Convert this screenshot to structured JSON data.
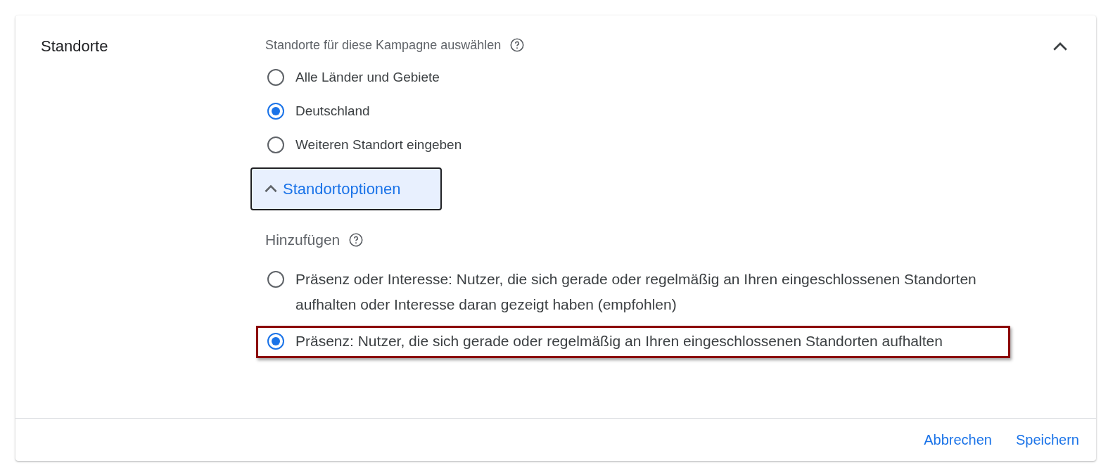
{
  "section": {
    "title": "Standorte",
    "expanded": true
  },
  "prompt": {
    "text": "Standorte für diese Kampagne auswählen"
  },
  "locations": [
    {
      "label": "Alle Länder und Gebiete",
      "selected": false
    },
    {
      "label": "Deutschland",
      "selected": true
    },
    {
      "label": "Weiteren Standort eingeben",
      "selected": false
    }
  ],
  "options_toggle": {
    "label": "Standortoptionen",
    "expanded": true
  },
  "include": {
    "label": "Hinzufügen",
    "options": [
      {
        "label": "Präsenz oder Interesse: Nutzer, die sich gerade oder regelmäßig an Ihren eingeschlossenen Standorten aufhalten oder Interesse daran gezeigt haben (empfohlen)",
        "selected": false,
        "highlighted": false
      },
      {
        "label": "Präsenz: Nutzer, die sich gerade oder regelmäßig an Ihren eingeschlossenen Standorten aufhalten",
        "selected": true,
        "highlighted": true
      }
    ]
  },
  "footer": {
    "buttons": [
      "Abbrechen",
      "Speichern"
    ]
  }
}
